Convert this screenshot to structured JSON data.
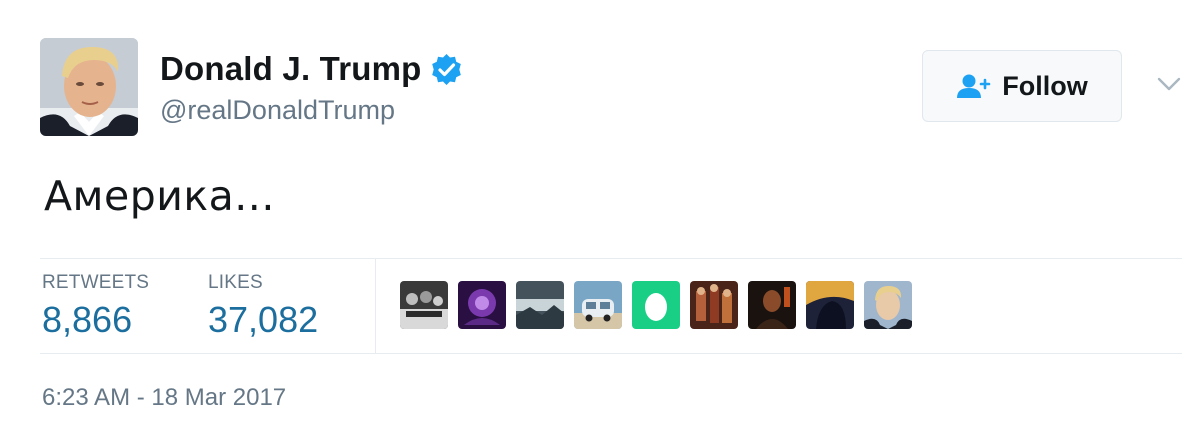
{
  "author": {
    "display_name": "Donald J. Trump",
    "handle": "@realDonaldTrump",
    "verified": true,
    "verified_color": "#1da1f2",
    "avatar_icon": "person-portrait"
  },
  "follow_button": {
    "label": "Follow",
    "icon": "add-person-icon",
    "icon_color": "#1da1f2"
  },
  "tweet": {
    "text": "Америка..."
  },
  "stats": {
    "retweets_label": "RETWEETS",
    "retweets_value": "8,866",
    "likes_label": "LIKES",
    "likes_value": "37,082",
    "value_color": "#1b6e9e"
  },
  "likers": [
    {
      "icon": "group-photo-avatar",
      "colors": [
        "#2b2b2b",
        "#d9d9d9"
      ]
    },
    {
      "icon": "purple-art-avatar",
      "colors": [
        "#3a1457",
        "#9b59d0"
      ]
    },
    {
      "icon": "landscape-avatar",
      "colors": [
        "#4a5a66",
        "#c9d4d9"
      ]
    },
    {
      "icon": "vehicle-avatar",
      "colors": [
        "#6f9ec0",
        "#d6c6a8"
      ]
    },
    {
      "icon": "default-egg-avatar",
      "colors": [
        "#19cf86",
        "#ffffff"
      ]
    },
    {
      "icon": "painting-avatar",
      "colors": [
        "#5a2a1e",
        "#c0703a"
      ]
    },
    {
      "icon": "dark-portrait-avatar",
      "colors": [
        "#1a120e",
        "#8a4b2a"
      ]
    },
    {
      "icon": "silhouette-avatar",
      "colors": [
        "#1d2238",
        "#e0a640"
      ]
    },
    {
      "icon": "person-portrait-avatar",
      "colors": [
        "#9fb6cc",
        "#e8c9a8"
      ]
    }
  ],
  "timestamp": "6:23 AM - 18 Mar 2017"
}
